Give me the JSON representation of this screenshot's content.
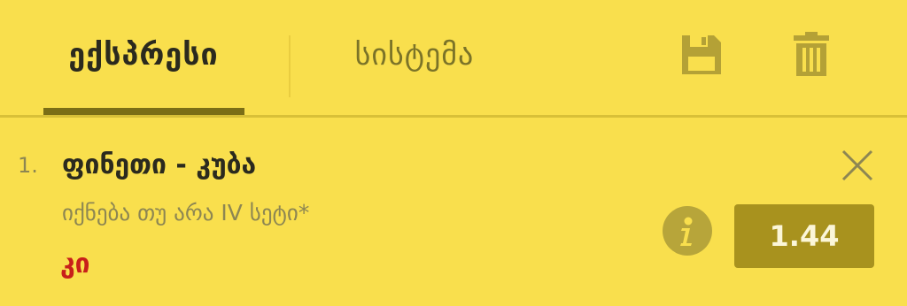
{
  "tabs": [
    {
      "label": "ექსპრესი",
      "active": true
    },
    {
      "label": "სისტემა",
      "active": false
    }
  ],
  "toolbar": {
    "save_icon": "floppy-disk-icon",
    "delete_icon": "trash-icon"
  },
  "bet": {
    "index": "1.",
    "event": "ფინეთი - კუბა",
    "market": "იქნება თუ არა IV სეტი*",
    "selection": "კი",
    "odds": "1.44",
    "info_icon": "info-icon",
    "close_icon": "close-icon"
  },
  "colors": {
    "background": "#f9df4d",
    "accent": "#7b6e16",
    "odds_bg": "#a8921e",
    "selection": "#c8201a"
  }
}
